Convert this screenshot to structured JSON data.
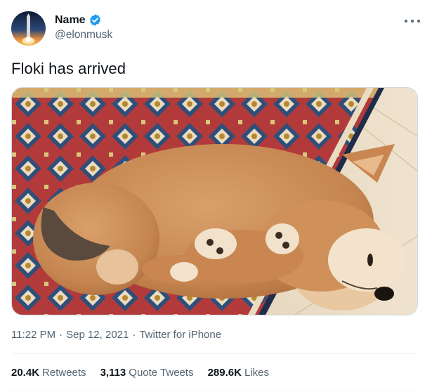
{
  "author": {
    "name": "Name",
    "handle": "@elonmusk",
    "verified": true,
    "verified_color": "#1d9bf0",
    "avatar_icon": "rocket-launch-avatar"
  },
  "tweet": {
    "text": "Floki has arrived",
    "media": {
      "subject": "sleeping shiba inu puppy on rug",
      "icon": "photo"
    }
  },
  "meta": {
    "time": "11:22 PM",
    "sep1": "·",
    "date": "Sep 12, 2021",
    "sep2": "·",
    "source": "Twitter for iPhone"
  },
  "stats": {
    "retweets_count": "20.4K",
    "retweets_label": "Retweets",
    "quotes_count": "3,113",
    "quotes_label": "Quote Tweets",
    "likes_count": "289.6K",
    "likes_label": "Likes"
  },
  "icons": {
    "more": "more-icon",
    "verified": "verified-badge-icon"
  },
  "colors": {
    "text_primary": "#0f1419",
    "text_secondary": "#536471",
    "divider": "#eff3f4"
  }
}
